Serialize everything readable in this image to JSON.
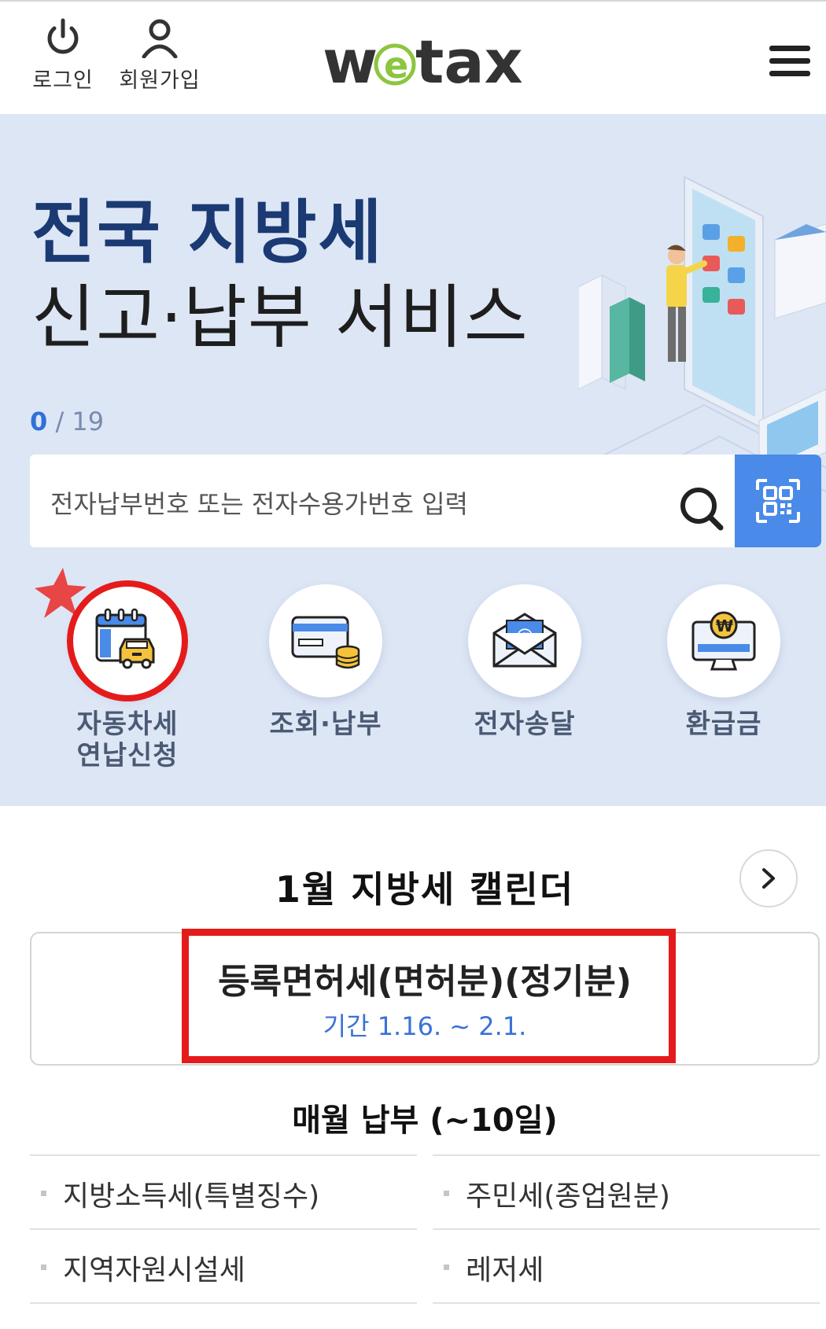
{
  "header": {
    "login_label": "로그인",
    "join_label": "회원가입",
    "logo_text_pre": "w",
    "logo_text_e": "e",
    "logo_text_post": "tax"
  },
  "hero": {
    "title_line1": "전국 지방세",
    "title_line2": "신고·납부 서비스",
    "counter_current": "0",
    "counter_separator": " / ",
    "counter_total": "19"
  },
  "search": {
    "placeholder": "전자납부번호 또는 전자수용가번호 입력"
  },
  "quick_menu": [
    {
      "label_line1": "자동차세",
      "label_line2": "연납신청"
    },
    {
      "label_line1": "조회·납부",
      "label_line2": ""
    },
    {
      "label_line1": "전자송달",
      "label_line2": ""
    },
    {
      "label_line1": "환급금",
      "label_line2": ""
    }
  ],
  "calendar": {
    "title": "1월 지방세 캘린더",
    "item_name": "등록면허세(면허분)(정기분)",
    "item_period": "기간 1.16. ~ 2.1."
  },
  "monthly": {
    "title": "매월 납부 (~10일)",
    "items": [
      "지방소득세(특별징수)",
      "주민세(종업원분)",
      "지역자원시설세",
      "레저세"
    ]
  },
  "colors": {
    "brand_navy": "#1b3a73",
    "hero_bg": "#dde6f5",
    "accent_blue": "#4a8ae8",
    "logo_green": "#8cc63f",
    "highlight_red": "#e51b1b"
  }
}
